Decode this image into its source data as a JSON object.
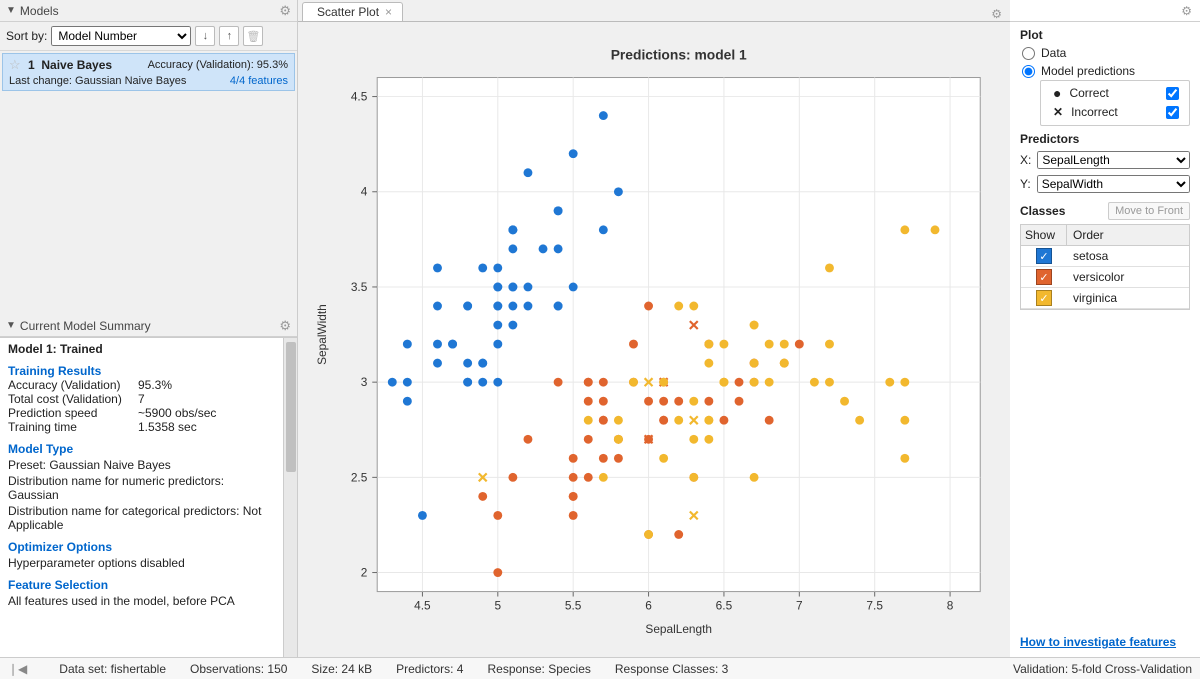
{
  "left": {
    "models_header": "Models",
    "sort_label": "Sort by:",
    "sort_value": "Model Number",
    "model_num": "1",
    "model_name": "Naive Bayes",
    "model_acc": "Accuracy (Validation): 95.3%",
    "last_change": "Last change: Gaussian Naive Bayes",
    "features": "4/4 features",
    "summary_header": "Current Model Summary",
    "model_title": "Model 1: Trained",
    "training_results": "Training Results",
    "acc_k": "Accuracy (Validation)",
    "acc_v": "95.3%",
    "cost_k": "Total cost (Validation)",
    "cost_v": "7",
    "speed_k": "Prediction speed",
    "speed_v": "~5900 obs/sec",
    "time_k": "Training time",
    "time_v": "1.5358 sec",
    "model_type": "Model Type",
    "preset": "Preset: Gaussian Naive Bayes",
    "dist_num": "Distribution name for numeric predictors: Gaussian",
    "dist_cat": "Distribution name for categorical predictors: Not Applicable",
    "optim_hdr": "Optimizer Options",
    "optim_txt": "Hyperparameter options disabled",
    "feat_hdr": "Feature Selection",
    "feat_txt": "All features used in the model, before PCA"
  },
  "tab": {
    "label": "Scatter Plot"
  },
  "right": {
    "plot_hdr": "Plot",
    "opt_data": "Data",
    "opt_pred": "Model predictions",
    "correct": "Correct",
    "incorrect": "Incorrect",
    "predictors_hdr": "Predictors",
    "x_label": "X:",
    "x_value": "SepalLength",
    "y_label": "Y:",
    "y_value": "SepalWidth",
    "classes_hdr": "Classes",
    "move_btn": "Move to Front",
    "th_show": "Show",
    "th_order": "Order",
    "class1": "setosa",
    "class2": "versicolor",
    "class3": "virginica",
    "link": "How to investigate features"
  },
  "status": {
    "dataset": "Data set: fishertable",
    "obs": "Observations: 150",
    "size": "Size: 24 kB",
    "predictors": "Predictors: 4",
    "response": "Response: Species",
    "resp_classes": "Response Classes: 3",
    "validation": "Validation: 5-fold Cross-Validation"
  },
  "chart_data": {
    "type": "scatter",
    "title": "Predictions: model 1",
    "xlabel": "SepalLength",
    "ylabel": "SepalWidth",
    "xlim": [
      4.2,
      8.2
    ],
    "ylim": [
      1.9,
      4.6
    ],
    "xticks": [
      4.5,
      5,
      5.5,
      6,
      6.5,
      7,
      7.5,
      8
    ],
    "yticks": [
      2,
      2.5,
      3,
      3.5,
      4,
      4.5
    ],
    "colors": {
      "setosa": "#1f77d4",
      "versicolor": "#e0642e",
      "virginica": "#f2b82e"
    },
    "series": [
      {
        "name": "setosa",
        "marker": "o",
        "points": [
          [
            5.1,
            3.5
          ],
          [
            4.9,
            3.0
          ],
          [
            4.7,
            3.2
          ],
          [
            4.6,
            3.1
          ],
          [
            5.0,
            3.6
          ],
          [
            5.4,
            3.9
          ],
          [
            4.6,
            3.4
          ],
          [
            5.0,
            3.4
          ],
          [
            4.4,
            2.9
          ],
          [
            4.9,
            3.1
          ],
          [
            5.4,
            3.7
          ],
          [
            4.8,
            3.4
          ],
          [
            4.8,
            3.0
          ],
          [
            4.3,
            3.0
          ],
          [
            5.8,
            4.0
          ],
          [
            5.7,
            4.4
          ],
          [
            5.4,
            3.9
          ],
          [
            5.1,
            3.5
          ],
          [
            5.7,
            3.8
          ],
          [
            5.1,
            3.8
          ],
          [
            5.4,
            3.4
          ],
          [
            5.1,
            3.7
          ],
          [
            4.6,
            3.6
          ],
          [
            5.1,
            3.3
          ],
          [
            4.8,
            3.4
          ],
          [
            5.0,
            3.0
          ],
          [
            5.0,
            3.4
          ],
          [
            5.2,
            3.5
          ],
          [
            5.2,
            3.4
          ],
          [
            4.7,
            3.2
          ],
          [
            4.8,
            3.1
          ],
          [
            5.4,
            3.4
          ],
          [
            5.2,
            4.1
          ],
          [
            5.5,
            4.2
          ],
          [
            4.9,
            3.1
          ],
          [
            5.0,
            3.2
          ],
          [
            5.5,
            3.5
          ],
          [
            4.9,
            3.6
          ],
          [
            4.4,
            3.0
          ],
          [
            5.1,
            3.4
          ],
          [
            5.0,
            3.5
          ],
          [
            4.5,
            2.3
          ],
          [
            4.4,
            3.2
          ],
          [
            5.0,
            3.5
          ],
          [
            5.1,
            3.8
          ],
          [
            4.8,
            3.0
          ],
          [
            5.1,
            3.8
          ],
          [
            4.6,
            3.2
          ],
          [
            5.3,
            3.7
          ],
          [
            5.0,
            3.3
          ]
        ]
      },
      {
        "name": "versicolor",
        "marker": "o",
        "points": [
          [
            7.0,
            3.2
          ],
          [
            6.4,
            3.2
          ],
          [
            6.9,
            3.1
          ],
          [
            5.5,
            2.3
          ],
          [
            6.5,
            2.8
          ],
          [
            5.7,
            2.8
          ],
          [
            4.9,
            2.4
          ],
          [
            6.6,
            2.9
          ],
          [
            5.2,
            2.7
          ],
          [
            5.0,
            2.0
          ],
          [
            5.9,
            3.0
          ],
          [
            6.0,
            2.2
          ],
          [
            6.1,
            2.9
          ],
          [
            5.6,
            2.9
          ],
          [
            6.7,
            3.1
          ],
          [
            5.6,
            3.0
          ],
          [
            5.8,
            2.7
          ],
          [
            6.2,
            2.2
          ],
          [
            5.6,
            2.5
          ],
          [
            5.9,
            3.2
          ],
          [
            6.1,
            2.8
          ],
          [
            6.3,
            2.5
          ],
          [
            6.1,
            2.8
          ],
          [
            6.4,
            2.9
          ],
          [
            6.6,
            3.0
          ],
          [
            6.8,
            2.8
          ],
          [
            6.7,
            3.0
          ],
          [
            6.0,
            2.9
          ],
          [
            5.7,
            2.6
          ],
          [
            5.5,
            2.4
          ],
          [
            5.5,
            2.4
          ],
          [
            5.8,
            2.7
          ],
          [
            6.0,
            2.7
          ],
          [
            5.4,
            3.0
          ],
          [
            6.0,
            3.4
          ],
          [
            6.7,
            3.1
          ],
          [
            5.6,
            3.0
          ],
          [
            5.5,
            2.5
          ],
          [
            5.5,
            2.6
          ],
          [
            6.1,
            3.0
          ],
          [
            5.8,
            2.6
          ],
          [
            5.0,
            2.3
          ],
          [
            5.6,
            2.7
          ],
          [
            5.7,
            3.0
          ],
          [
            5.7,
            2.9
          ],
          [
            6.2,
            2.9
          ],
          [
            5.1,
            2.5
          ],
          [
            5.7,
            2.8
          ]
        ]
      },
      {
        "name": "versicolor",
        "marker": "x",
        "points": [
          [
            6.3,
            3.3
          ],
          [
            6.1,
            3.0
          ],
          [
            6.0,
            2.7
          ]
        ]
      },
      {
        "name": "virginica",
        "marker": "o",
        "points": [
          [
            5.8,
            2.7
          ],
          [
            7.1,
            3.0
          ],
          [
            6.3,
            2.9
          ],
          [
            6.5,
            3.0
          ],
          [
            7.6,
            3.0
          ],
          [
            7.3,
            2.9
          ],
          [
            6.7,
            2.5
          ],
          [
            7.2,
            3.6
          ],
          [
            6.5,
            3.2
          ],
          [
            6.4,
            2.7
          ],
          [
            6.8,
            3.0
          ],
          [
            5.7,
            2.5
          ],
          [
            5.8,
            2.8
          ],
          [
            6.4,
            3.2
          ],
          [
            6.5,
            3.0
          ],
          [
            7.7,
            3.8
          ],
          [
            7.7,
            2.6
          ],
          [
            6.0,
            2.2
          ],
          [
            6.9,
            3.2
          ],
          [
            5.6,
            2.8
          ],
          [
            7.7,
            2.8
          ],
          [
            6.3,
            2.7
          ],
          [
            6.7,
            3.3
          ],
          [
            7.2,
            3.2
          ],
          [
            6.2,
            2.8
          ],
          [
            6.1,
            3.0
          ],
          [
            6.4,
            2.8
          ],
          [
            7.2,
            3.0
          ],
          [
            7.4,
            2.8
          ],
          [
            7.9,
            3.8
          ],
          [
            6.4,
            2.8
          ],
          [
            6.1,
            2.6
          ],
          [
            7.7,
            3.0
          ],
          [
            6.3,
            3.4
          ],
          [
            6.4,
            3.1
          ],
          [
            6.9,
            3.1
          ],
          [
            6.7,
            3.1
          ],
          [
            6.9,
            3.1
          ],
          [
            5.8,
            2.7
          ],
          [
            6.8,
            3.2
          ],
          [
            6.7,
            3.3
          ],
          [
            6.7,
            3.0
          ],
          [
            6.3,
            2.5
          ],
          [
            6.5,
            3.0
          ],
          [
            6.2,
            3.4
          ],
          [
            5.9,
            3.0
          ]
        ]
      },
      {
        "name": "virginica",
        "marker": "x",
        "points": [
          [
            6.3,
            2.8
          ],
          [
            4.9,
            2.5
          ],
          [
            6.0,
            3.0
          ],
          [
            6.3,
            2.3
          ]
        ]
      }
    ]
  }
}
